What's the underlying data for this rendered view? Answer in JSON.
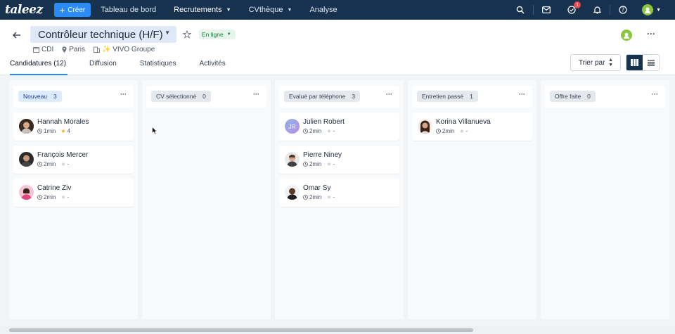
{
  "nav": {
    "logo": "taleez",
    "create_label": "Créer",
    "links": [
      "Tableau de bord",
      "Recrutements",
      "CVthèque",
      "Analyse"
    ],
    "notification_count": "1"
  },
  "job": {
    "title": "Contrôleur technique (H/F)",
    "status": "En ligne",
    "contract": "CDI",
    "location": "Paris",
    "company": "✨ VIVO Groupe"
  },
  "tabs": [
    "Candidatures (12)",
    "Diffusion",
    "Statistiques",
    "Activités"
  ],
  "sort_label": "Trier par",
  "columns": [
    {
      "name": "Nouveau",
      "count": "3",
      "cards": [
        {
          "name": "Hannah Morales",
          "time": "1min",
          "rating": "4",
          "rated": true
        },
        {
          "name": "François Mercer",
          "time": "2min",
          "rating": "-",
          "rated": false
        },
        {
          "name": "Catrine Ziv",
          "time": "2min",
          "rating": "-",
          "rated": false
        }
      ]
    },
    {
      "name": "CV sélectionné",
      "count": "0",
      "cards": []
    },
    {
      "name": "Evalué par téléphone",
      "count": "3",
      "cards": [
        {
          "name": "Julien Robert",
          "initials": "JR",
          "time": "2min",
          "rating": "-",
          "rated": false
        },
        {
          "name": "Pierre Niney",
          "time": "2min",
          "rating": "-",
          "rated": false
        },
        {
          "name": "Omar Sy",
          "time": "2min",
          "rating": "-",
          "rated": false
        }
      ]
    },
    {
      "name": "Entretien passé",
      "count": "1",
      "cards": [
        {
          "name": "Korina Villanueva",
          "time": "2min",
          "rating": "-",
          "rated": false
        }
      ]
    },
    {
      "name": "Offre faite",
      "count": "0",
      "cards": []
    }
  ],
  "colors": {
    "nav_bg": "#16324f",
    "accent": "#2a8af6",
    "status_green": "#15803d",
    "star_gold": "#f5a623"
  }
}
